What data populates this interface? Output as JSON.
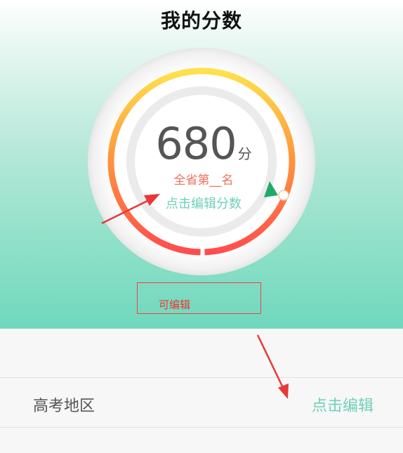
{
  "page": {
    "title": "我的分数"
  },
  "score": {
    "value": "680",
    "unit": "分",
    "rank_text": "全省第__名",
    "edit_label": "点击编辑分数"
  },
  "annotation": {
    "editable_label": "可编辑"
  },
  "region": {
    "label": "高考地区",
    "action": "点击编辑"
  },
  "colors": {
    "accent": "#6fd0b8",
    "rank": "#f0705a",
    "gauge_start": "#ff4d4d",
    "gauge_mid": "#ff9a3c",
    "gauge_end": "#ffe14d",
    "annotation": "#e33333"
  },
  "icons": {
    "pointer": "green-triangle-pointer-icon",
    "arrow": "red-arrow-icon"
  }
}
